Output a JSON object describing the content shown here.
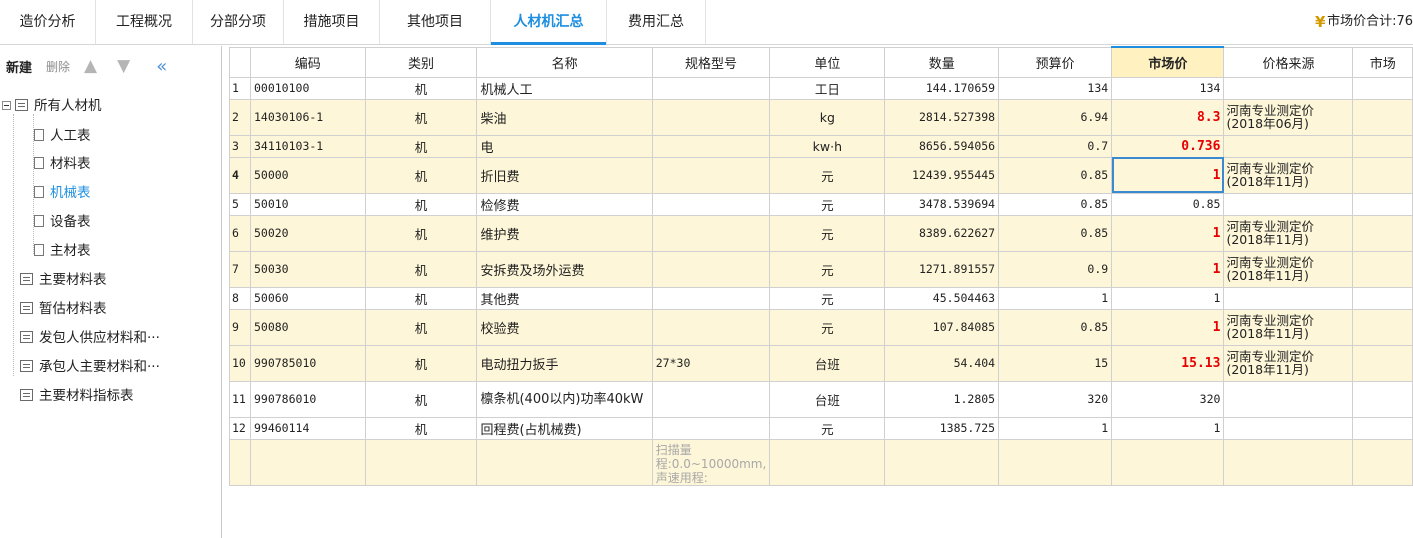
{
  "tabs": [
    {
      "label": "造价分析"
    },
    {
      "label": "工程概况"
    },
    {
      "label": "分部分项"
    },
    {
      "label": "措施项目"
    },
    {
      "label": "其他项目"
    },
    {
      "label": "人材机汇总"
    },
    {
      "label": "费用汇总"
    }
  ],
  "active_tab": "人材机汇总",
  "market_total": {
    "icon": "coin-icon",
    "label": "市场价合计:76"
  },
  "toolbar": {
    "new_label": "新建",
    "delete_label": "删除",
    "up_icon": "arrow-up-icon",
    "down_icon": "arrow-down-icon",
    "collapse_icon": "double-chevron-left-icon"
  },
  "tree": {
    "root": "所有人材机",
    "children": [
      "人工表",
      "材料表",
      "机械表",
      "设备表",
      "主材表"
    ],
    "active": "机械表",
    "others": [
      "主要材料表",
      "暂估材料表",
      "发包人供应材料和···",
      "承包人主要材料和···",
      "主要材料指标表"
    ]
  },
  "columns": [
    "编码",
    "类别",
    "名称",
    "规格型号",
    "单位",
    "数量",
    "预算价",
    "市场价",
    "价格来源",
    "市场"
  ],
  "rows": [
    {
      "no": "1",
      "code": "00010100",
      "cat": "机",
      "name": "机械人工",
      "spec": "",
      "unit": "工日",
      "qty": "144.170659",
      "budget": "134",
      "market": "134",
      "source": "",
      "hl": false,
      "red": false
    },
    {
      "no": "2",
      "code": "14030106-1",
      "cat": "机",
      "name": "柴油",
      "spec": "",
      "unit": "kg",
      "qty": "2814.527398",
      "budget": "6.94",
      "market": "8.3",
      "source": "河南专业测定价(2018年06月)",
      "hl": true,
      "red": true
    },
    {
      "no": "3",
      "code": "34110103-1",
      "cat": "机",
      "name": "电",
      "spec": "",
      "unit": "kw·h",
      "qty": "8656.594056",
      "budget": "0.7",
      "market": "0.736",
      "source": "",
      "hl": true,
      "red": true
    },
    {
      "no": "4",
      "code": "50000",
      "cat": "机",
      "name": "折旧费",
      "spec": "",
      "unit": "元",
      "qty": "12439.955445",
      "budget": "0.85",
      "market": "1",
      "source": "河南专业测定价(2018年11月)",
      "hl": true,
      "red": true
    },
    {
      "no": "5",
      "code": "50010",
      "cat": "机",
      "name": "检修费",
      "spec": "",
      "unit": "元",
      "qty": "3478.539694",
      "budget": "0.85",
      "market": "0.85",
      "source": "",
      "hl": false,
      "red": false
    },
    {
      "no": "6",
      "code": "50020",
      "cat": "机",
      "name": "维护费",
      "spec": "",
      "unit": "元",
      "qty": "8389.622627",
      "budget": "0.85",
      "market": "1",
      "source": "河南专业测定价(2018年11月)",
      "hl": true,
      "red": true
    },
    {
      "no": "7",
      "code": "50030",
      "cat": "机",
      "name": "安拆费及场外运费",
      "spec": "",
      "unit": "元",
      "qty": "1271.891557",
      "budget": "0.9",
      "market": "1",
      "source": "河南专业测定价(2018年11月)",
      "hl": true,
      "red": true
    },
    {
      "no": "8",
      "code": "50060",
      "cat": "机",
      "name": "其他费",
      "spec": "",
      "unit": "元",
      "qty": "45.504463",
      "budget": "1",
      "market": "1",
      "source": "",
      "hl": false,
      "red": false
    },
    {
      "no": "9",
      "code": "50080",
      "cat": "机",
      "name": "校验费",
      "spec": "",
      "unit": "元",
      "qty": "107.84085",
      "budget": "0.85",
      "market": "1",
      "source": "河南专业测定价(2018年11月)",
      "hl": true,
      "red": true
    },
    {
      "no": "10",
      "code": "990785010",
      "cat": "机",
      "name": "电动扭力扳手",
      "spec": "27*30",
      "unit": "台班",
      "qty": "54.404",
      "budget": "15",
      "market": "15.13",
      "source": "河南专业测定价(2018年11月)",
      "hl": true,
      "red": true
    },
    {
      "no": "11",
      "code": "990786010",
      "cat": "机",
      "name": "檩条机(400以内)功率40kW",
      "spec": "",
      "unit": "台班",
      "qty": "1.2805",
      "budget": "320",
      "market": "320",
      "source": "",
      "hl": false,
      "red": false
    },
    {
      "no": "12",
      "code": "99460114",
      "cat": "机",
      "name": "回程费(占机械费)",
      "spec": "",
      "unit": "元",
      "qty": "1385.725",
      "budget": "1",
      "market": "1",
      "source": "",
      "hl": false,
      "red": false
    }
  ],
  "tooltip_note": "扫描量程:0.0~10000mm,声速用程:"
}
